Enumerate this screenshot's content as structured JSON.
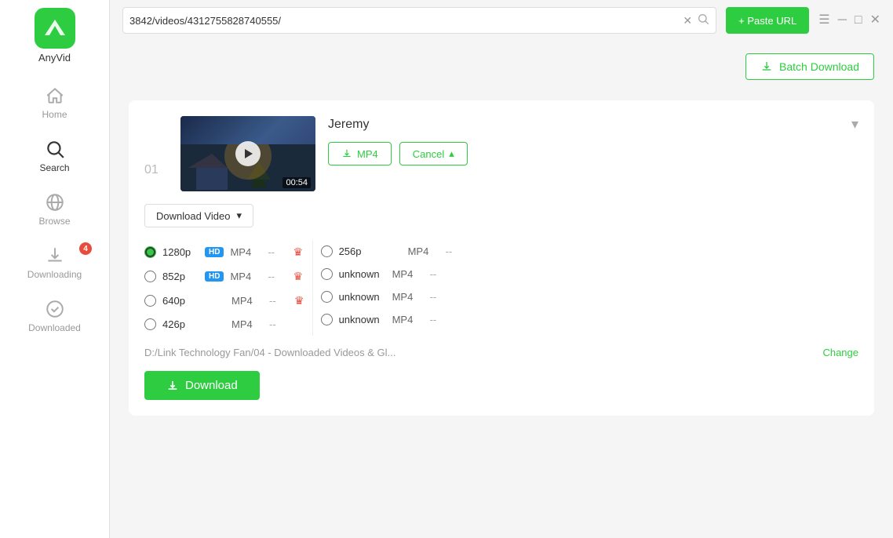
{
  "app": {
    "name": "AnyVid"
  },
  "titlebar": {
    "url_value": "3842/videos/4312755828740555/",
    "paste_url_label": "+ Paste URL"
  },
  "batch_download": {
    "label": "Batch Download"
  },
  "sidebar": {
    "items": [
      {
        "id": "home",
        "label": "Home",
        "active": false
      },
      {
        "id": "search",
        "label": "Search",
        "active": true
      },
      {
        "id": "browse",
        "label": "Browse",
        "active": false
      },
      {
        "id": "downloading",
        "label": "Downloading",
        "active": false,
        "badge": "4"
      },
      {
        "id": "downloaded",
        "label": "Downloaded",
        "active": false
      }
    ]
  },
  "video": {
    "number": "01",
    "title": "Jeremy",
    "duration": "00:54",
    "mp4_button": "MP4",
    "cancel_button": "Cancel"
  },
  "download_options": {
    "dropdown_label": "Download Video",
    "qualities_left": [
      {
        "value": "1280p",
        "hd": true,
        "format": "MP4",
        "dash": "--",
        "selected": true
      },
      {
        "value": "852p",
        "hd": true,
        "format": "MP4",
        "dash": "--",
        "selected": false
      },
      {
        "value": "640p",
        "hd": false,
        "format": "MP4",
        "dash": "--",
        "selected": false
      },
      {
        "value": "426p",
        "hd": false,
        "format": "MP4",
        "dash": "--",
        "selected": false
      }
    ],
    "qualities_right": [
      {
        "value": "256p",
        "hd": false,
        "format": "MP4",
        "dash": "--",
        "selected": false
      },
      {
        "value": "unknown",
        "hd": false,
        "format": "MP4",
        "dash": "--",
        "selected": false
      },
      {
        "value": "unknown",
        "hd": false,
        "format": "MP4",
        "dash": "--",
        "selected": false
      },
      {
        "value": "unknown",
        "hd": false,
        "format": "MP4",
        "dash": "--",
        "selected": false
      }
    ],
    "path": "D:/Link Technology Fan/04 - Downloaded Videos & Gl...",
    "change_label": "Change",
    "download_button": "Download"
  },
  "window_controls": {
    "menu": "☰",
    "minimize": "─",
    "maximize": "□",
    "close": "✕"
  }
}
